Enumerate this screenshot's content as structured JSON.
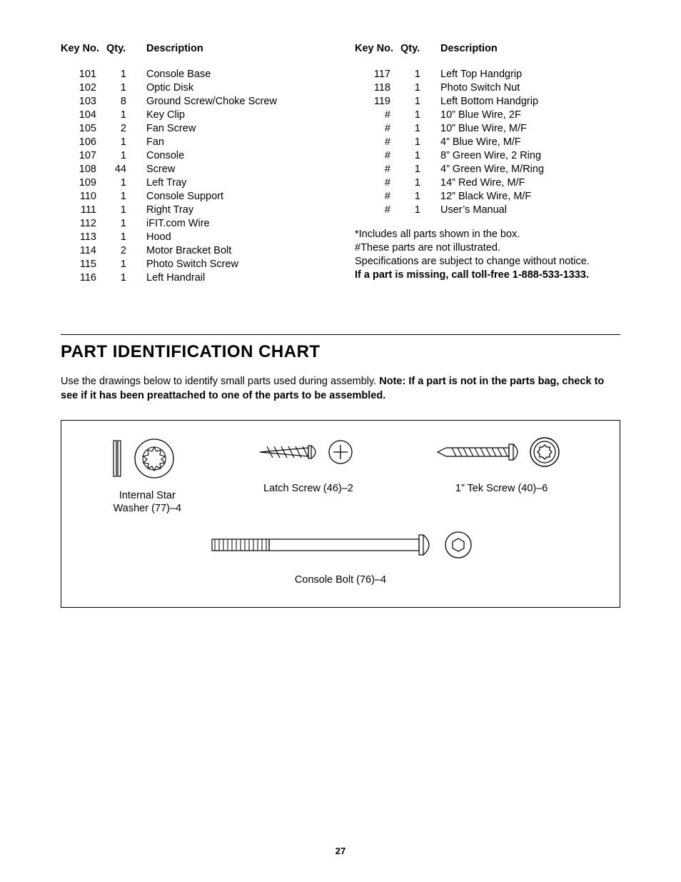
{
  "headers": {
    "keyno": "Key No.",
    "qty": "Qty.",
    "desc": "Description"
  },
  "left_rows": [
    {
      "k": "101",
      "q": "1",
      "d": "Console Base"
    },
    {
      "k": "102",
      "q": "1",
      "d": "Optic Disk"
    },
    {
      "k": "103",
      "q": "8",
      "d": "Ground Screw/Choke Screw"
    },
    {
      "k": "104",
      "q": "1",
      "d": "Key Clip"
    },
    {
      "k": "105",
      "q": "2",
      "d": "Fan Screw"
    },
    {
      "k": "106",
      "q": "1",
      "d": "Fan"
    },
    {
      "k": "107",
      "q": "1",
      "d": "Console"
    },
    {
      "k": "108",
      "q": "44",
      "d": "Screw"
    },
    {
      "k": "109",
      "q": "1",
      "d": "Left Tray"
    },
    {
      "k": "110",
      "q": "1",
      "d": "Console Support"
    },
    {
      "k": "111",
      "q": "1",
      "d": "Right Tray"
    },
    {
      "k": "112",
      "q": "1",
      "d": "iFIT.com Wire"
    },
    {
      "k": "113",
      "q": "1",
      "d": "Hood"
    },
    {
      "k": "114",
      "q": "2",
      "d": "Motor Bracket Bolt"
    },
    {
      "k": "115",
      "q": "1",
      "d": "Photo Switch Screw"
    },
    {
      "k": "116",
      "q": "1",
      "d": "Left Handrail"
    }
  ],
  "right_rows": [
    {
      "k": "117",
      "q": "1",
      "d": "Left Top Handgrip"
    },
    {
      "k": "118",
      "q": "1",
      "d": "Photo Switch Nut"
    },
    {
      "k": "119",
      "q": "1",
      "d": "Left Bottom Handgrip"
    },
    {
      "k": "#",
      "q": "1",
      "d": "10” Blue Wire, 2F"
    },
    {
      "k": "#",
      "q": "1",
      "d": "10” Blue Wire, M/F"
    },
    {
      "k": "#",
      "q": "1",
      "d": "4” Blue Wire, M/F"
    },
    {
      "k": "#",
      "q": "1",
      "d": "8” Green Wire, 2 Ring"
    },
    {
      "k": "#",
      "q": "1",
      "d": "4” Green Wire, M/Ring"
    },
    {
      "k": "#",
      "q": "1",
      "d": "14” Red Wire, M/F"
    },
    {
      "k": "#",
      "q": "1",
      "d": "12” Black Wire, M/F"
    },
    {
      "k": "#",
      "q": "1",
      "d": "User’s Manual"
    }
  ],
  "notes": {
    "n1": "*Includes all parts shown in the box.",
    "n2": "#These parts are not illustrated.",
    "n3": "Specifications are subject to change without notice.",
    "n4": "If a part is missing, call toll-free 1-888-533-1333."
  },
  "section_title": "PART IDENTIFICATION CHART",
  "intro": {
    "plain": "Use the drawings below to identify small parts used during assembly. ",
    "bold": "Note: If a part is not in the parts bag, check to see if it has been preattached to one of the parts to be assembled."
  },
  "parts_chart": {
    "star_washer": "Internal Star\nWasher (77)–4",
    "latch_screw": "Latch Screw (46)–2",
    "tek_screw": "1” Tek Screw (40)–6",
    "console_bolt": "Console Bolt (76)–4"
  },
  "page_number": "27"
}
